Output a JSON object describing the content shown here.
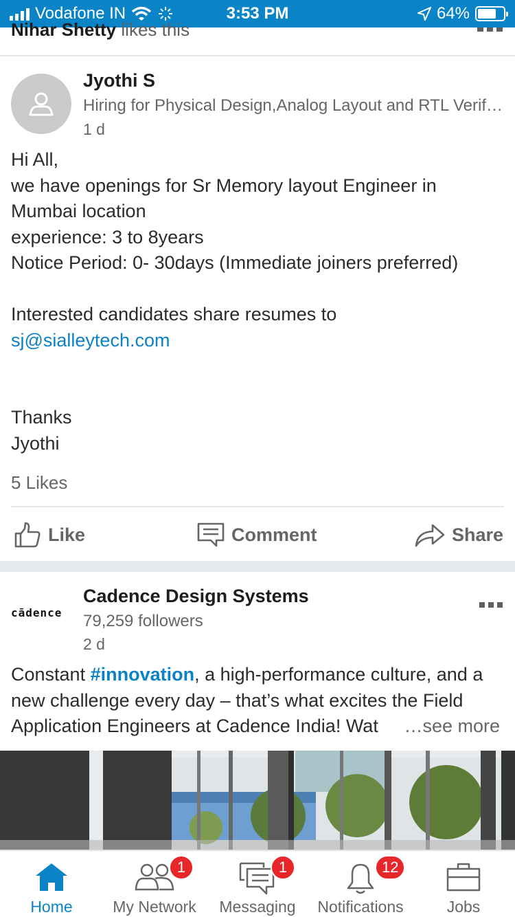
{
  "status_bar": {
    "carrier": "Vodafone IN",
    "time": "3:53 PM",
    "battery": "64%",
    "battery_level": 0.64
  },
  "feed": {
    "top_activity": {
      "name": "Nihar Shetty",
      "text": "likes this"
    },
    "post1": {
      "author": "Jyothi S",
      "headline": "Hiring for Physical Design,Analog Layout and RTL Verif…",
      "time": "1 d",
      "lines": [
        "Hi All,",
        "we have openings for Sr Memory layout Engineer in",
        "Mumbai location",
        "experience: 3 to 8years",
        "Notice Period: 0- 30days (Immediate joiners preferred)"
      ],
      "lines2": [
        "Interested candidates share resumes to"
      ],
      "email": "sj@sialleytech.com",
      "signoff": [
        "Thanks",
        "Jyothi"
      ],
      "likes": "5 Likes",
      "actions": {
        "like": "Like",
        "comment": "Comment",
        "share": "Share"
      }
    },
    "post2": {
      "company": "Cadence Design Systems",
      "logo_text": "cādence",
      "followers": "79,259 followers",
      "time": "2 d",
      "line1_pre": "Constant ",
      "hashtag": "#innovation",
      "line1_post": ", a high-performance culture, and a",
      "line2": "new challenge every day – that’s what excites the Field",
      "line3": "Application Engineers at Cadence India! Wat",
      "see_more": "…see more"
    }
  },
  "nav": {
    "home": "Home",
    "network": "My Network",
    "network_badge": "1",
    "messaging": "Messaging",
    "messaging_badge": "1",
    "notifications": "Notifications",
    "notifications_badge": "12",
    "jobs": "Jobs"
  },
  "colors": {
    "accent": "#0a84c6",
    "badge": "#e62629",
    "link": "#0b82c5"
  }
}
